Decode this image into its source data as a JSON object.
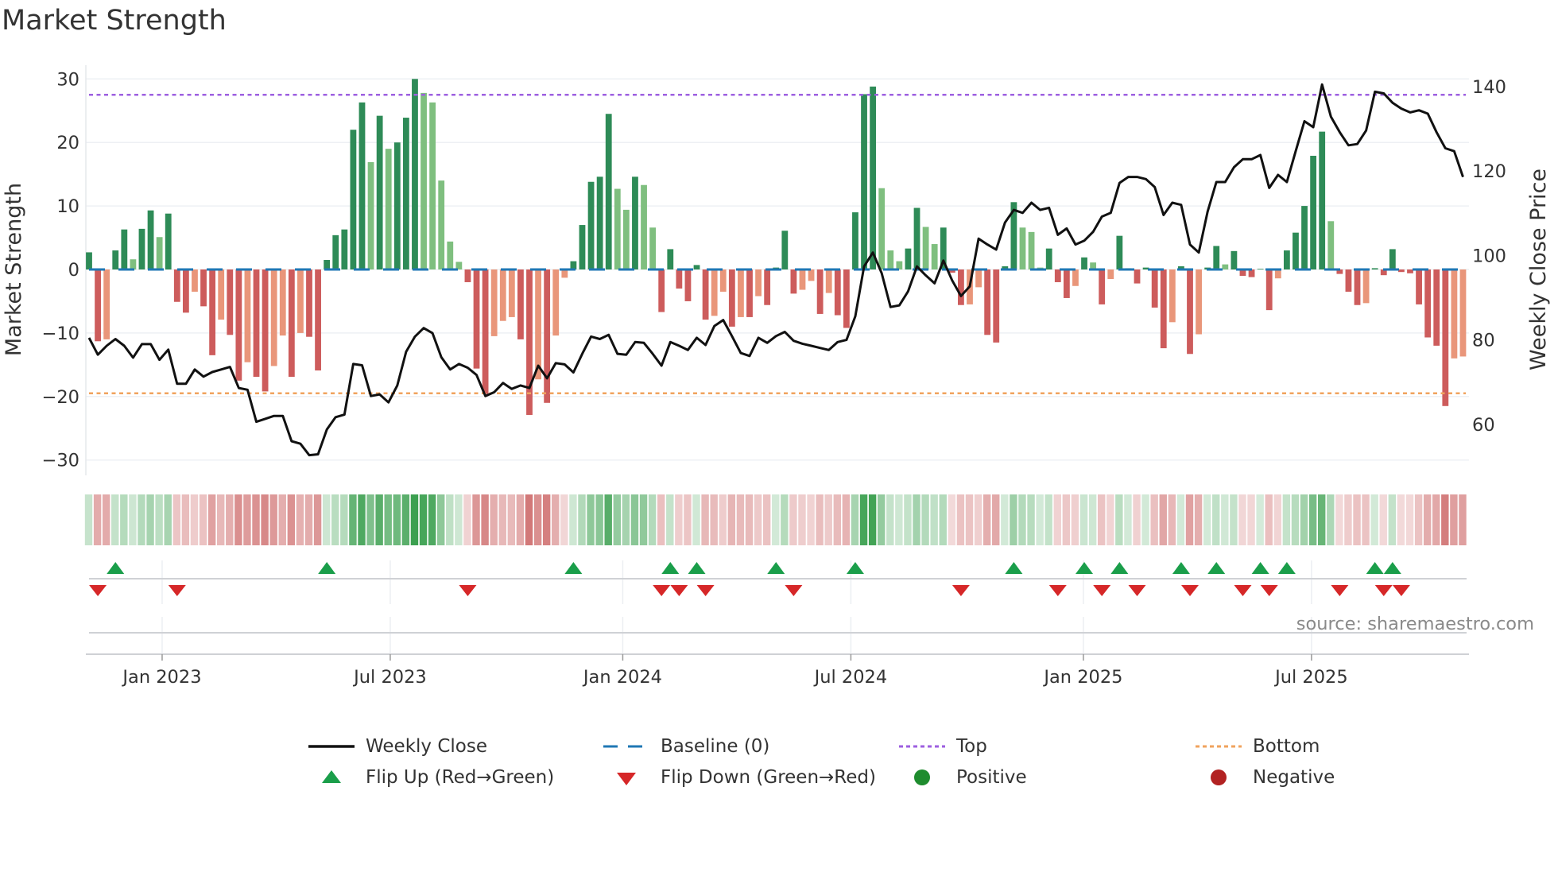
{
  "chart_data": {
    "type": "bar",
    "title": "Market Strength",
    "ylabel": "Market Strength",
    "y2label": "Weekly Close Price",
    "ylim": [
      -32,
      32
    ],
    "y2lim": [
      50,
      144
    ],
    "yticks": [
      "30",
      "20",
      "10",
      "0",
      "−10",
      "−20",
      "−30"
    ],
    "ytick_values": [
      30,
      20,
      10,
      0,
      -10,
      -20,
      -30
    ],
    "y2ticks": [
      "140",
      "120",
      "100",
      "80",
      "60"
    ],
    "y2tick_values": [
      140,
      120,
      100,
      80,
      60
    ],
    "x_ticks": [
      {
        "label": "Jan 2023",
        "week": 8.3
      },
      {
        "label": "Jul 2023",
        "week": 34.2
      },
      {
        "label": "Jan 2024",
        "week": 60.6
      },
      {
        "label": "Jul 2024",
        "week": 86.5
      },
      {
        "label": "Jan 2025",
        "week": 112.9
      },
      {
        "label": "Jul 2025",
        "week": 138.8
      }
    ],
    "top_level": 27.5,
    "bottom_level": -19.5,
    "baseline": 0,
    "strength": [
      2.7,
      -11.3,
      -11,
      3.0,
      6.3,
      1.6,
      6.4,
      9.3,
      5.1,
      8.8,
      -5.1,
      -6.8,
      -3.5,
      -5.8,
      -13.5,
      -7.9,
      -10.3,
      -17.5,
      -14.6,
      -16.9,
      -19.2,
      -15.2,
      -10.4,
      -16.9,
      -10.0,
      -10.6,
      -15.9,
      1.5,
      5.4,
      6.3,
      22.0,
      26.3,
      16.9,
      24.2,
      19.0,
      20.0,
      23.9,
      30.0,
      27.8,
      26.3,
      14.0,
      4.4,
      1.2,
      -2.0,
      -15.6,
      -19.6,
      -10.5,
      -8.1,
      -7.5,
      -11.0,
      -22.9,
      -17.3,
      -21.0,
      -10.4,
      -1.3,
      1.3,
      7.0,
      13.8,
      14.6,
      24.5,
      12.7,
      9.4,
      14.6,
      13.3,
      6.6,
      -6.7,
      3.2,
      -3.0,
      -5.0,
      0.7,
      -7.9,
      -7.3,
      -3.5,
      -9.0,
      -7.5,
      -7.5,
      -4.2,
      -5.6,
      0.3,
      6.1,
      -3.8,
      -3.2,
      -1.8,
      -7.0,
      -3.7,
      -7.2,
      -9.2,
      9.0,
      27.6,
      28.8,
      12.8,
      3.0,
      1.3,
      3.3,
      9.7,
      6.7,
      4.0,
      6.6,
      -0.5,
      -5.6,
      -5.5,
      -2.8,
      -10.3,
      -11.5,
      0.5,
      10.6,
      6.6,
      5.9,
      0.3,
      3.3,
      -2.0,
      -4.5,
      -2.6,
      1.9,
      1.1,
      -5.5,
      -1.5,
      5.3,
      0.2,
      -2.2,
      0.3,
      -6.0,
      -12.4,
      -8.3,
      0.5,
      -13.3,
      -10.2,
      0.3,
      3.7,
      0.8,
      2.9,
      -1.0,
      -1.2,
      0.1,
      -6.4,
      -1.4,
      3.0,
      5.8,
      10.0,
      17.9,
      21.7,
      7.6,
      -0.7,
      -3.5,
      -5.6,
      -5.3,
      0.2,
      -0.9,
      3.2,
      -0.4,
      -0.6,
      -5.5,
      -10.7,
      -12.0,
      -21.5,
      -14.0,
      -13.7
    ],
    "weekly_close": [
      80.5,
      76.5,
      78.6,
      80.2,
      78.6,
      75.8,
      79.0,
      79.0,
      75.3,
      77.7,
      69.6,
      69.6,
      73.0,
      71.3,
      72.4,
      73.0,
      73.6,
      68.6,
      68.2,
      60.6,
      61.3,
      62.0,
      62.0,
      56.0,
      55.4,
      52.7,
      52.9,
      58.8,
      61.7,
      62.3,
      74.3,
      74.0,
      66.7,
      67.1,
      65.2,
      69.2,
      77.2,
      80.8,
      82.8,
      81.6,
      75.9,
      73.0,
      74.3,
      73.4,
      71.7,
      66.7,
      67.6,
      69.8,
      68.4,
      69.2,
      68.6,
      73.9,
      70.9,
      74.5,
      74.2,
      72.3,
      76.7,
      80.8,
      80.2,
      81.2,
      76.7,
      76.5,
      79.5,
      79.3,
      76.7,
      73.9,
      79.5,
      78.6,
      77.6,
      80.5,
      78.8,
      83.3,
      84.7,
      80.9,
      76.9,
      76.2,
      80.5,
      79.3,
      80.9,
      81.9,
      79.8,
      79.1,
      78.6,
      78.1,
      77.6,
      79.5,
      80.0,
      85.6,
      97.4,
      100.7,
      95.8,
      87.8,
      88.2,
      91.5,
      97.4,
      95.3,
      93.4,
      98.8,
      94.1,
      90.4,
      92.7,
      104.0,
      102.6,
      101.4,
      107.8,
      110.8,
      110.1,
      112.5,
      110.8,
      111.3,
      104.9,
      106.4,
      102.6,
      103.5,
      105.6,
      109.2,
      110.1,
      117.2,
      118.6,
      118.6,
      118.1,
      116.2,
      109.6,
      112.5,
      112.0,
      102.6,
      100.7,
      110.4,
      117.4,
      117.4,
      120.9,
      122.8,
      122.8,
      123.8,
      116.0,
      119.1,
      117.4,
      124.7,
      131.8,
      130.4,
      140.5,
      132.9,
      129.2,
      126.1,
      126.4,
      129.6,
      138.8,
      138.4,
      136.2,
      134.8,
      133.9,
      134.4,
      133.6,
      129.2,
      125.4,
      124.7,
      118.6
    ],
    "flip_up_weeks": [
      3,
      27,
      55,
      66,
      69,
      78,
      87,
      105,
      113,
      117,
      124,
      128,
      133,
      136,
      146,
      148
    ],
    "flip_down_weeks": [
      1,
      10,
      43,
      65,
      67,
      70,
      80,
      99,
      110,
      115,
      119,
      125,
      131,
      134,
      142,
      147,
      149
    ],
    "colors": {
      "pos_strong": "#2e8b57",
      "pos_weak": "#7fbf7f",
      "neg_strong": "#cd5c5c",
      "neg_weak": "#e9967a",
      "line": "#111111",
      "baseline": "#1f77b4",
      "top": "#9d5fe0",
      "bottom": "#f0a35e",
      "flip_up": "#1a9e4a",
      "flip_down": "#d62728",
      "positive": "#1e8c2e",
      "negative": "#b22222"
    },
    "source": "source: sharemaestro.com",
    "legend": {
      "weekly_close": "Weekly Close",
      "baseline": "Baseline (0)",
      "top": "Top",
      "bottom": "Bottom",
      "flip_up": "Flip Up (Red→Green)",
      "flip_down": "Flip Down (Green→Red)",
      "positive": "Positive",
      "negative": "Negative"
    },
    "legend_placement": "bottom"
  }
}
